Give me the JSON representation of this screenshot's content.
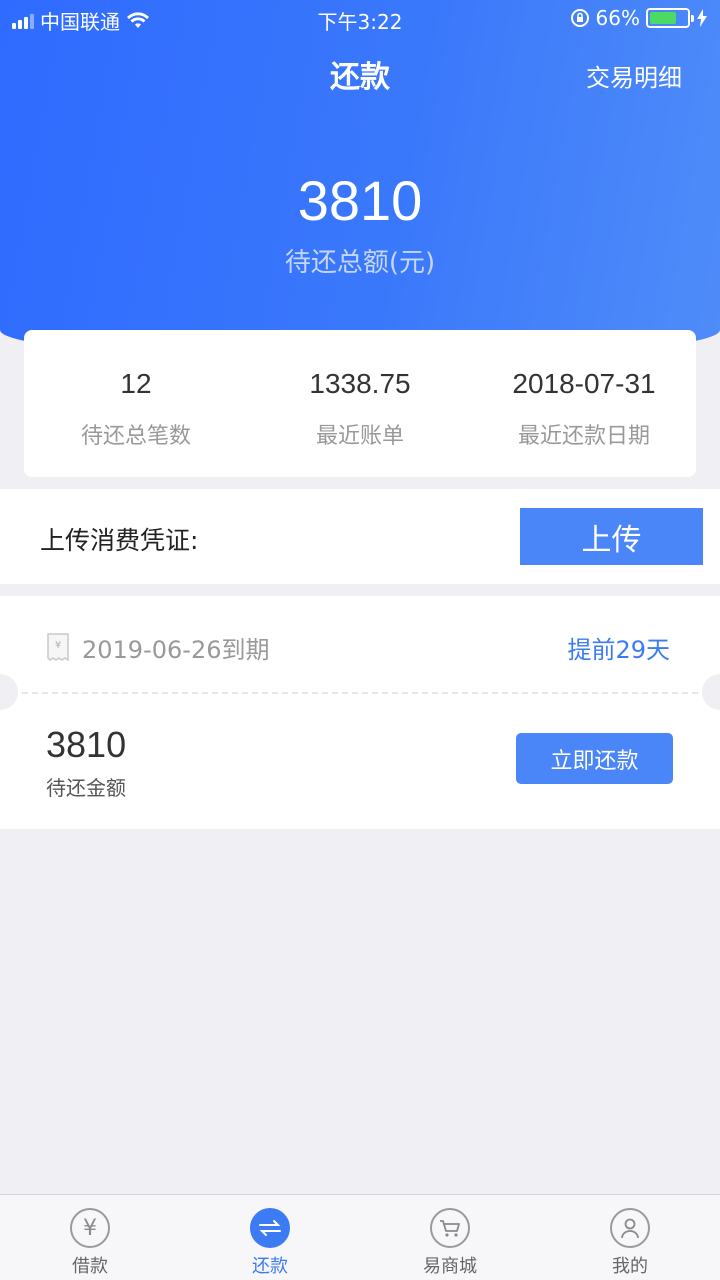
{
  "status_bar": {
    "carrier": "中国联通",
    "time": "下午3:22",
    "battery": "66%"
  },
  "nav": {
    "title": "还款",
    "right_link": "交易明细"
  },
  "total": {
    "amount": "3810",
    "label": "待还总额(元)"
  },
  "summary": [
    {
      "value": "12",
      "label": "待还总笔数"
    },
    {
      "value": "1338.75",
      "label": "最近账单"
    },
    {
      "value": "2018-07-31",
      "label": "最近还款日期"
    }
  ],
  "upload": {
    "label": "上传消费凭证:",
    "button": "上传"
  },
  "bill": {
    "due_date": "2019-06-26到期",
    "advance": "提前29天",
    "amount": "3810",
    "amount_label": "待还金额",
    "pay_button": "立即还款"
  },
  "tabs": [
    {
      "label": "借款",
      "icon": "yen-icon"
    },
    {
      "label": "还款",
      "icon": "exchange-icon",
      "active": true
    },
    {
      "label": "易商城",
      "icon": "cart-icon"
    },
    {
      "label": "我的",
      "icon": "user-icon"
    }
  ],
  "colors": {
    "primary": "#3c7bf3",
    "header": "#3a78fb",
    "background": "#efeff4"
  }
}
